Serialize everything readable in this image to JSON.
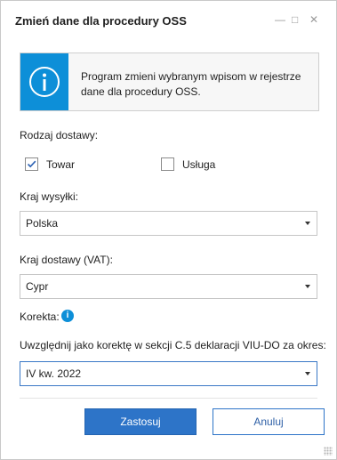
{
  "window": {
    "title": "Zmień dane dla procedury OSS",
    "minimize_glyph": "—",
    "maximize_glyph": "□",
    "close_glyph": "✕"
  },
  "info_box": {
    "icon": "info-icon",
    "text": "Program zmieni wybranym wpisom w rejestrze dane dla procedury OSS."
  },
  "delivery_type": {
    "label": "Rodzaj dostawy:",
    "options": [
      {
        "label": "Towar",
        "checked": true
      },
      {
        "label": "Usługa",
        "checked": false
      }
    ]
  },
  "shipping_country": {
    "label": "Kraj wysyłki:",
    "value": "Polska"
  },
  "delivery_country": {
    "label": "Kraj dostawy (VAT):",
    "value": "Cypr"
  },
  "correction": {
    "label": "Korekta:",
    "info_glyph": "i",
    "description": "Uwzględnij jako korektę w sekcji C.5 deklaracji VIU-DO za okres:",
    "period": "IV kw. 2022"
  },
  "buttons": {
    "apply": "Zastosuj",
    "cancel": "Anuluj"
  },
  "colors": {
    "accent": "#0d8fd8",
    "primary_button": "#2d74c8"
  }
}
